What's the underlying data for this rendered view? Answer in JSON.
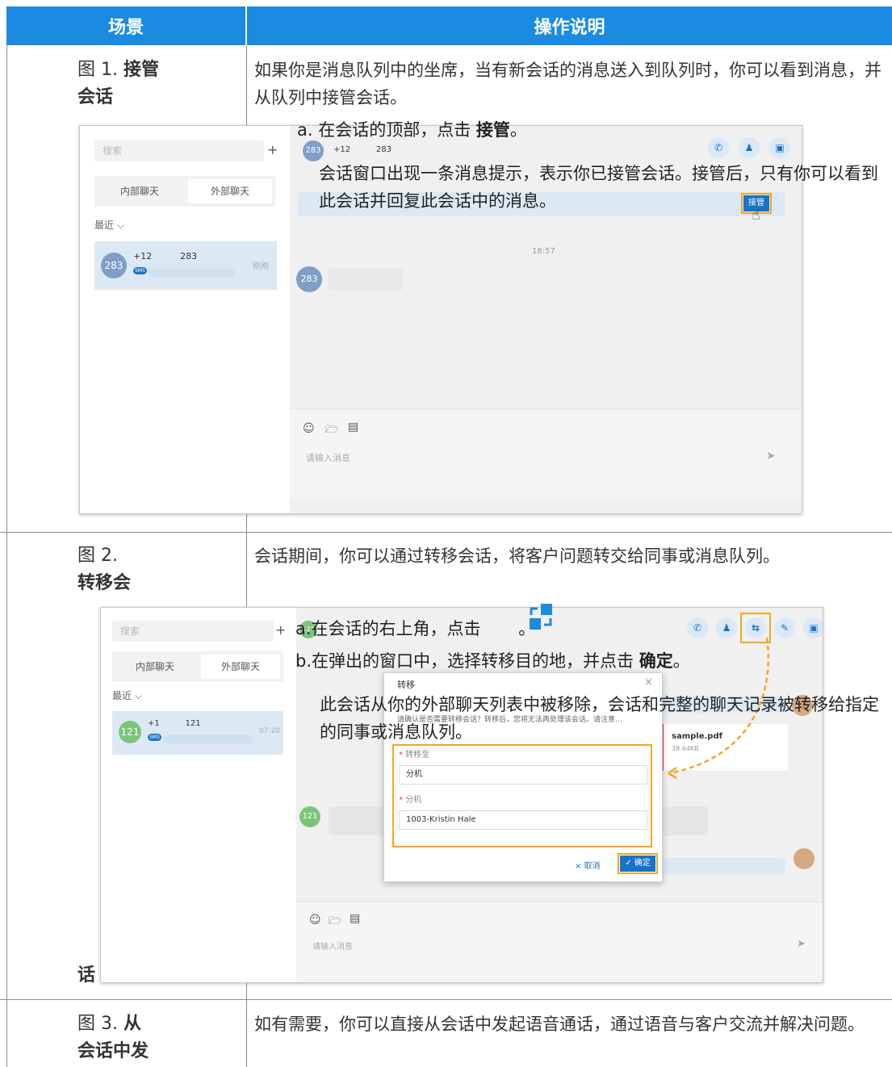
{
  "table": {
    "header": {
      "col1": "场景",
      "col2": "操作说明"
    },
    "rows": [
      {
        "label_prefix": "图",
        "label_num": "1.",
        "label_bold1": "接管",
        "label_bold2": "会话",
        "desc": "如果你是消息队列中的坐席，当有新会话的消息送入到队列时，你可以看到消息，并从队列中接管会话。",
        "steps": {
          "a_text": "a. 在会话的顶部，点击",
          "a_bold": "接管",
          "a_end": "。",
          "note": "会话窗口出现一条消息提示，表示你已接管会话。接管后，只有你可以看到此会话并回复此会话中的消息。"
        }
      },
      {
        "label_prefix": "图",
        "label_num": "2.",
        "label_bold1": "转移会",
        "label_bold2": "话",
        "desc": "会话期间，你可以通过转移会话，将客户问题转交给同事或消息队列。",
        "steps": {
          "a_label": "a.",
          "a_text": "在会话的右上角，点击",
          "a_end": "。",
          "b_label": "b.",
          "b_text": "在弹出的窗口中，选择转移目的地，并点击",
          "b_bold": "确定",
          "b_end": "。",
          "note": "此会话从你的外部聊天列表中被移除，会话和完整的聊天记录被转移给指定的同事或消息队列。"
        }
      },
      {
        "label_prefix": "图",
        "label_num": "3.",
        "label_bold1": "从",
        "label_bold2": "会话中发",
        "desc": "如有需要，你可以直接从会话中发起语音通话，通过语音与客户交流并解决问题。"
      }
    ]
  },
  "shot1": {
    "search_placeholder": "搜索",
    "plus": "+",
    "tab_internal": "内部聊天",
    "tab_external": "外部聊天",
    "recent": "最近 ⌵",
    "conv_name": "+12          283",
    "conv_avatar": "283",
    "conv_time": "刚刚",
    "sms_badge": "SMS",
    "header_num": "+12          283",
    "header_avatar": "283",
    "takeover_btn": "接管",
    "timestamp": "18:57",
    "msg_avatar": "283",
    "input_placeholder": "请输入消息",
    "icons": [
      "phone-icon",
      "add-user-icon",
      "archive-icon"
    ]
  },
  "shot2": {
    "search_placeholder": "搜索",
    "plus": "+",
    "tab_internal": "内部聊天",
    "tab_external": "外部聊天",
    "recent": "最近 ⌵",
    "conv_name": "+1          121",
    "conv_avatar": "121",
    "conv_time": "07:20",
    "sms_badge": "SMS",
    "header_avatar": "121",
    "msg_avatar": "121",
    "file_name": "sample.pdf",
    "file_size": "38.64KB",
    "input_placeholder": "请输入消息",
    "dialog": {
      "title": "转移",
      "close": "×",
      "hint": "请确认是否需要转移会话？转移后，您将无法再处理该会话。请注意…",
      "field1_label": "转移至",
      "field1_value": "分机",
      "field2_label": "分机",
      "field2_value": "1003-Kristin Hale",
      "cancel": "× 取消",
      "ok": "✓ 确定"
    },
    "icons": [
      "phone-icon",
      "add-user-icon",
      "transfer-icon",
      "note-icon",
      "archive-icon"
    ]
  },
  "colors": {
    "header_bg": "#1a8be0",
    "accent_orange": "#f5a623",
    "avatar_blue": "#7f9fc7",
    "avatar_green": "#7cc47a"
  }
}
